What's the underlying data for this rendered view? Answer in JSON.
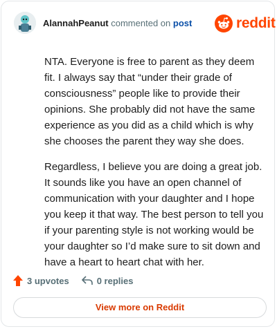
{
  "header": {
    "author": "AlannahPeanut",
    "action_text": "commented on",
    "post_link": "post",
    "brand_name": "reddit"
  },
  "comment": {
    "paragraphs": [
      "NTA. Everyone is free to parent as they deem fit. I always say that “under their grade of consciousness” people like to provide their opinions. She probably did not have the same experience as you did as a child which is why she chooses the parent they way she does.",
      "Regardless, I believe you are doing a great job. It sounds like you have an open channel of communication with your daughter and I hope you keep it that way. The best person to tell you if your parenting style is not working would be your daughter so I’d make sure to sit down and have a heart to heart chat with her."
    ]
  },
  "footer": {
    "upvotes": "3 upvotes",
    "replies": "0 replies",
    "view_more": "View more on Reddit"
  },
  "colors": {
    "brand": "#ff4500",
    "link": "#0a4fa8",
    "muted": "#576f76",
    "button_text": "#d93a00"
  },
  "icons": {
    "avatar": "avatar",
    "brand": "reddit-logo-icon",
    "upvote": "upvote-arrow-icon",
    "reply": "reply-arrow-icon"
  }
}
